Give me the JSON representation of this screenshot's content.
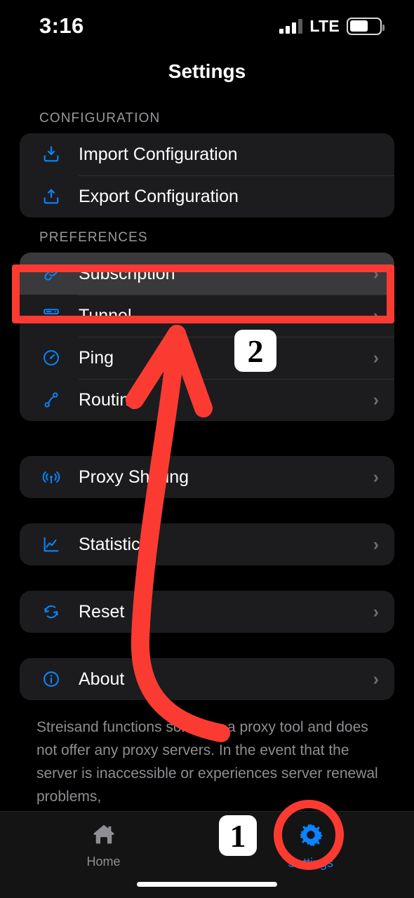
{
  "status_bar": {
    "time": "3:16",
    "network": "LTE",
    "signal_bars": 4,
    "signal_active_bars": 3,
    "battery_percent": 62,
    "battery_icon": "battery-icon",
    "signal_icon": "cellular-signal-icon"
  },
  "header": {
    "title": "Settings"
  },
  "sections": [
    {
      "header": "CONFIGURATION",
      "rows": [
        {
          "label": "Import Configuration",
          "icon": "import-tray-icon",
          "chevron": false
        },
        {
          "label": "Export Configuration",
          "icon": "export-tray-icon",
          "chevron": false
        }
      ]
    },
    {
      "header": "PREFERENCES",
      "rows": [
        {
          "label": "Subscription",
          "icon": "link-chain-icon",
          "chevron": true,
          "selected": true
        },
        {
          "label": "Tunnel",
          "icon": "server-rack-icon",
          "chevron": true,
          "selected": false
        },
        {
          "label": "Ping",
          "icon": "speedometer-icon",
          "chevron": true,
          "selected": false
        },
        {
          "label": "Routing",
          "icon": "route-nodes-icon",
          "chevron": true,
          "selected": false
        }
      ]
    },
    {
      "header": "",
      "rows": [
        {
          "label": "Proxy Sharing",
          "icon": "broadcast-icon",
          "chevron": true
        }
      ]
    },
    {
      "header": "",
      "rows": [
        {
          "label": "Statistics",
          "icon": "chart-line-icon",
          "chevron": true
        }
      ]
    },
    {
      "header": "",
      "rows": [
        {
          "label": "Reset",
          "icon": "refresh-circle-icon",
          "chevron": true
        }
      ]
    },
    {
      "header": "",
      "rows": [
        {
          "label": "About",
          "icon": "info-circle-icon",
          "chevron": true
        }
      ]
    }
  ],
  "footnote": "Streisand functions solely as a proxy tool and does not offer any proxy servers. In the event that the server is inaccessible or experiences server renewal problems,",
  "tab_bar": {
    "tabs": [
      {
        "label": "Home",
        "icon": "home-icon",
        "active": false
      },
      {
        "label": "Settings",
        "icon": "gear-icon",
        "active": true
      }
    ]
  },
  "annotations": {
    "accent_color": "#fb3b32",
    "step_badges": [
      {
        "number": "1",
        "target": "settings-tab"
      },
      {
        "number": "2",
        "target": "subscription-row"
      }
    ],
    "highlight_box_target": "Subscription",
    "highlight_circle_target": "Settings",
    "arrow_from": "settings-tab",
    "arrow_to": "subscription-row"
  },
  "chevron_glyph": "›"
}
